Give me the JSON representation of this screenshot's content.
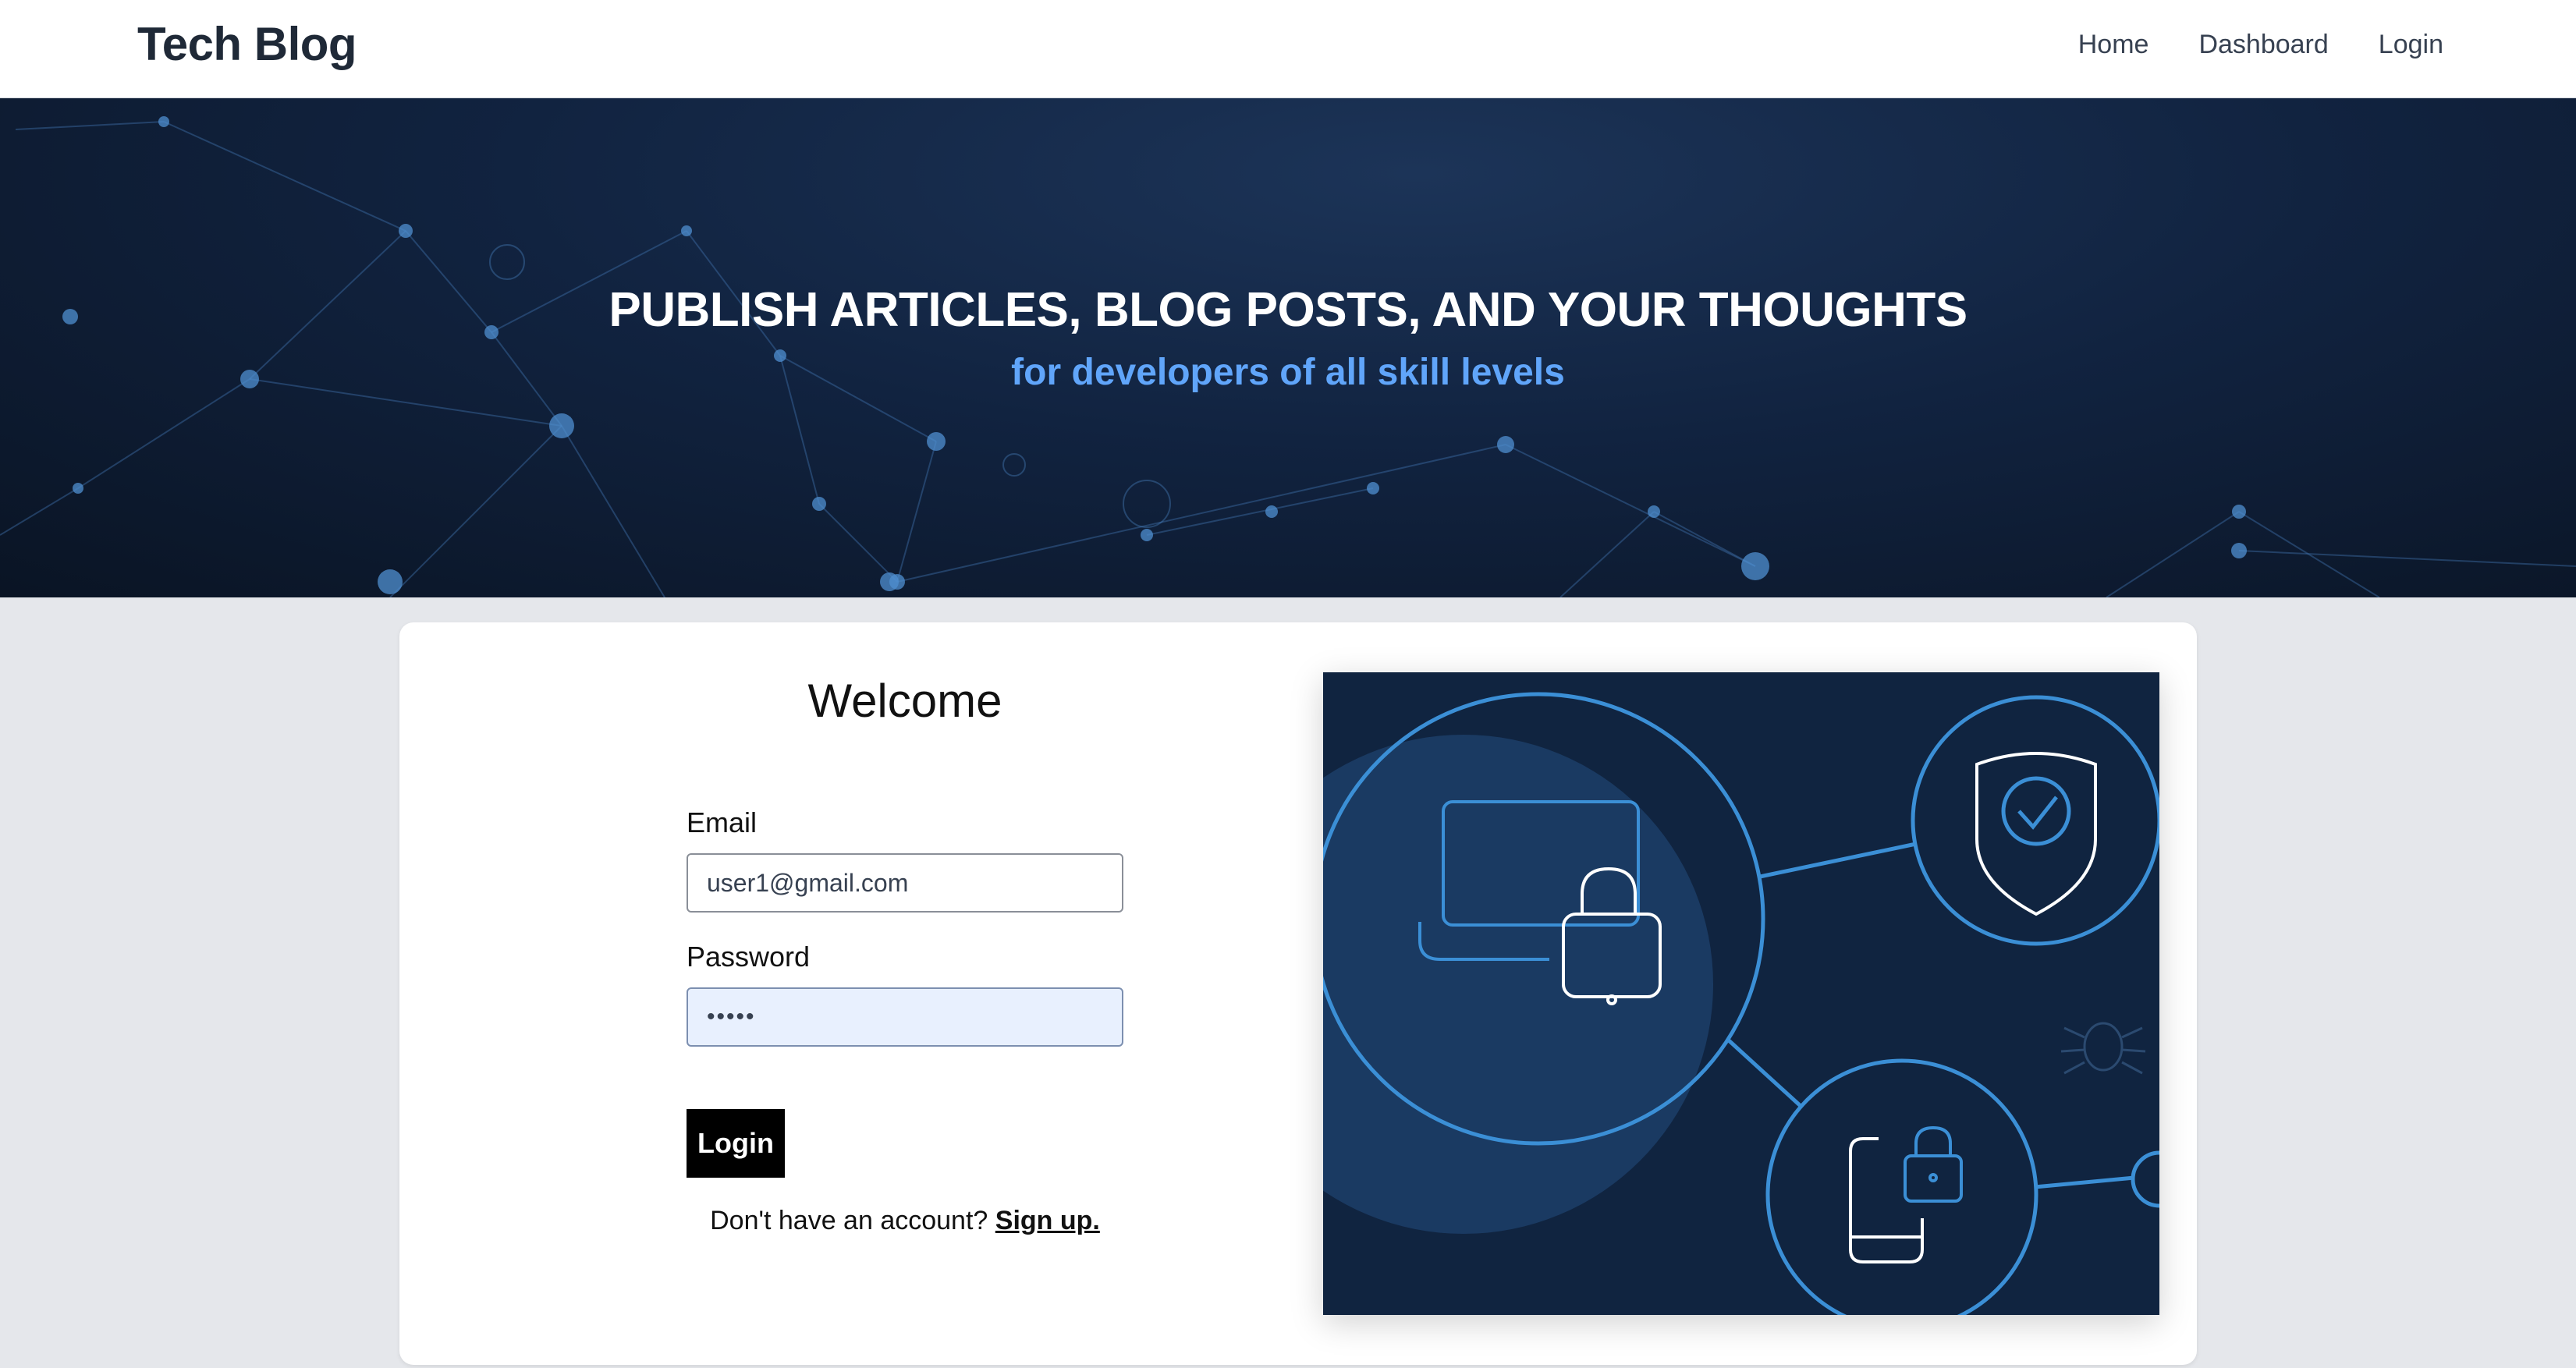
{
  "navbar": {
    "brand": "Tech Blog",
    "links": [
      {
        "label": "Home"
      },
      {
        "label": "Dashboard"
      },
      {
        "label": "Login"
      }
    ]
  },
  "hero": {
    "title": "PUBLISH ARTICLES, BLOG POSTS, AND YOUR THOUGHTS",
    "subtitle": "for developers of all skill levels"
  },
  "login_form": {
    "heading": "Welcome",
    "email_label": "Email",
    "email_value": "user1@gmail.com",
    "password_label": "Password",
    "password_value": "•••••",
    "submit_label": "Login",
    "signup_prompt": "Don't have an account?",
    "signup_link": "Sign up."
  },
  "colors": {
    "hero_background": "#112340",
    "hero_subtitle": "#60a5fa",
    "page_background": "#e5e7eb",
    "button": "#000000",
    "illustration_background": "#102440",
    "illustration_accent": "#3b8fd6"
  },
  "icons": [
    "laptop-lock-icon",
    "shield-check-icon",
    "phone-lock-icon",
    "bug-icon"
  ]
}
